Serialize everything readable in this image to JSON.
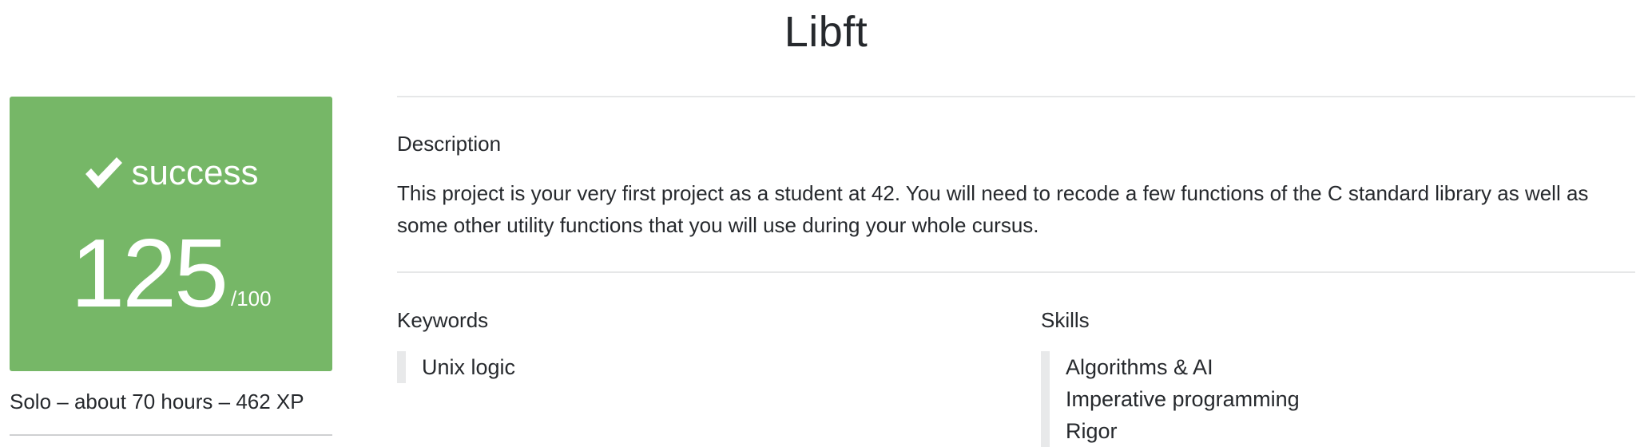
{
  "project": {
    "title": "Libft",
    "status": "success",
    "score": "125",
    "score_max": "/100",
    "meta": "Solo – about 70 hours – 462 XP",
    "accent_color": "#76b767"
  },
  "description": {
    "heading": "Description",
    "text": "This project is your very first project as a student at 42. You will need to recode a few functions of the C standard library as well as some other utility functions that you will use during your whole cursus."
  },
  "keywords": {
    "heading": "Keywords",
    "items": [
      "Unix logic"
    ]
  },
  "skills": {
    "heading": "Skills",
    "items": [
      "Algorithms & AI",
      "Imperative programming",
      "Rigor"
    ]
  },
  "icons": {
    "status": "check-icon"
  }
}
